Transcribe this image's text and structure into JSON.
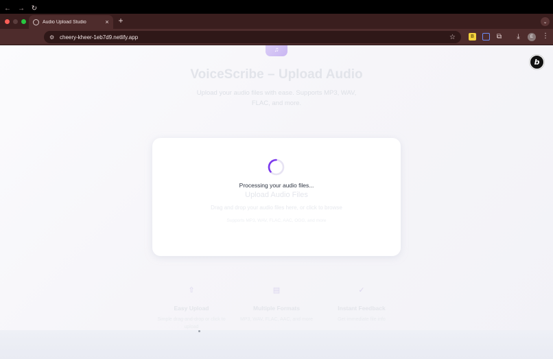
{
  "browser": {
    "tab_title": "Audio Upload Studio",
    "tab_close": "×",
    "new_tab": "+",
    "menu_chevron": "⌄",
    "url": "cheery-kheer-1eb7d9.netlify.app",
    "nav": {
      "back": "←",
      "forward": "→",
      "reload": "↻"
    },
    "star": "☆",
    "profile_initial": "E",
    "extensions": [
      {
        "name": "yellow-extension-icon",
        "glyph": "B"
      },
      {
        "name": "blue-extension-icon",
        "glyph": "▢"
      },
      {
        "name": "puzzle-extension-icon",
        "glyph": "⧉"
      },
      {
        "name": "download-icon",
        "glyph": "⤓"
      }
    ],
    "kebab": "⋮"
  },
  "page": {
    "logo_glyph": "♫",
    "title": "VoiceScribe – Upload Audio",
    "subtitle": "Upload your audio files with ease. Supports MP3, WAV, FLAC, and more.",
    "upload_card": {
      "heading": "Upload Audio Files",
      "description": "Drag and drop your audio files here, or click to browse",
      "formats": "Supports MP3, WAV, FLAC, AAC, OGG, and more"
    },
    "processing_text": "Processing your audio files...",
    "features": [
      {
        "icon": "upload-icon",
        "glyph": "⇧",
        "title": "Easy Upload",
        "description": "Simple drag-and-drop or click to upload"
      },
      {
        "icon": "file-audio-icon",
        "glyph": "▤",
        "title": "Multiple Formats",
        "description": "MP3, WAV, FLAC, AAC, and more"
      },
      {
        "icon": "check-circle-icon",
        "glyph": "✓",
        "title": "Instant Feedback",
        "description": "Get immediate file info"
      }
    ],
    "floating_badge": "b"
  },
  "colors": {
    "accent": "#7c3aed",
    "spinner_track": "#e7e3f3",
    "tab_bg": "#4e2c2c",
    "chrome_bg": "#3a1e1e"
  }
}
